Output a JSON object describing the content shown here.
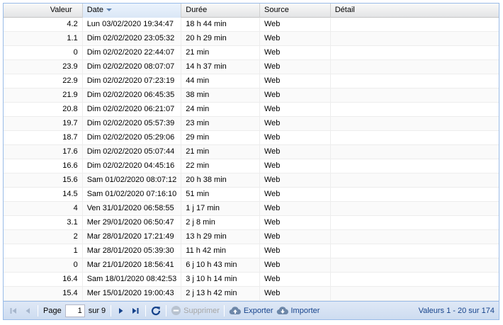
{
  "columns": {
    "valeur": "Valeur",
    "date": "Date",
    "duree": "Durée",
    "source": "Source",
    "detail": "Détail"
  },
  "rows": [
    {
      "valeur": "4.2",
      "date": "Lun 03/02/2020 19:34:47",
      "duree": "18 h 44 min",
      "source": "Web",
      "detail": ""
    },
    {
      "valeur": "1.1",
      "date": "Dim 02/02/2020 23:05:32",
      "duree": "20 h 29 min",
      "source": "Web",
      "detail": ""
    },
    {
      "valeur": "0",
      "date": "Dim 02/02/2020 22:44:07",
      "duree": "21 min",
      "source": "Web",
      "detail": ""
    },
    {
      "valeur": "23.9",
      "date": "Dim 02/02/2020 08:07:07",
      "duree": "14 h 37 min",
      "source": "Web",
      "detail": ""
    },
    {
      "valeur": "22.9",
      "date": "Dim 02/02/2020 07:23:19",
      "duree": "44 min",
      "source": "Web",
      "detail": ""
    },
    {
      "valeur": "21.9",
      "date": "Dim 02/02/2020 06:45:35",
      "duree": "38 min",
      "source": "Web",
      "detail": ""
    },
    {
      "valeur": "20.8",
      "date": "Dim 02/02/2020 06:21:07",
      "duree": "24 min",
      "source": "Web",
      "detail": ""
    },
    {
      "valeur": "19.7",
      "date": "Dim 02/02/2020 05:57:39",
      "duree": "23 min",
      "source": "Web",
      "detail": ""
    },
    {
      "valeur": "18.7",
      "date": "Dim 02/02/2020 05:29:06",
      "duree": "29 min",
      "source": "Web",
      "detail": ""
    },
    {
      "valeur": "17.6",
      "date": "Dim 02/02/2020 05:07:44",
      "duree": "21 min",
      "source": "Web",
      "detail": ""
    },
    {
      "valeur": "16.6",
      "date": "Dim 02/02/2020 04:45:16",
      "duree": "22 min",
      "source": "Web",
      "detail": ""
    },
    {
      "valeur": "15.6",
      "date": "Sam 01/02/2020 08:07:12",
      "duree": "20 h 38 min",
      "source": "Web",
      "detail": ""
    },
    {
      "valeur": "14.5",
      "date": "Sam 01/02/2020 07:16:10",
      "duree": "51 min",
      "source": "Web",
      "detail": ""
    },
    {
      "valeur": "4",
      "date": "Ven 31/01/2020 06:58:55",
      "duree": "1 j 17 min",
      "source": "Web",
      "detail": ""
    },
    {
      "valeur": "3.1",
      "date": "Mer 29/01/2020 06:50:47",
      "duree": "2 j 8 min",
      "source": "Web",
      "detail": ""
    },
    {
      "valeur": "2",
      "date": "Mar 28/01/2020 17:21:49",
      "duree": "13 h 29 min",
      "source": "Web",
      "detail": ""
    },
    {
      "valeur": "1",
      "date": "Mar 28/01/2020 05:39:30",
      "duree": "11 h 42 min",
      "source": "Web",
      "detail": ""
    },
    {
      "valeur": "0",
      "date": "Mar 21/01/2020 18:56:41",
      "duree": "6 j 10 h 43 min",
      "source": "Web",
      "detail": ""
    },
    {
      "valeur": "16.4",
      "date": "Sam 18/01/2020 08:42:53",
      "duree": "3 j 10 h 14 min",
      "source": "Web",
      "detail": ""
    },
    {
      "valeur": "15.4",
      "date": "Mer 15/01/2020 19:00:43",
      "duree": "2 j 13 h 42 min",
      "source": "Web",
      "detail": ""
    }
  ],
  "toolbar": {
    "page_label": "Page",
    "page_value": "1",
    "of_label": "sur 9",
    "delete_label": "Supprimer",
    "export_label": "Exporter",
    "import_label": "Importer",
    "display_info": "Valeurs 1 - 20 sur 174"
  },
  "icons": {
    "first": "first-page-icon",
    "prev": "prev-page-icon",
    "next": "next-page-icon",
    "last": "last-page-icon",
    "refresh": "refresh-icon",
    "delete": "delete-icon",
    "export": "cloud-upload-icon",
    "import": "cloud-download-icon"
  },
  "colors": {
    "accent": "#15428b",
    "border": "#99bbe8",
    "disabled": "#a6b6cc"
  }
}
